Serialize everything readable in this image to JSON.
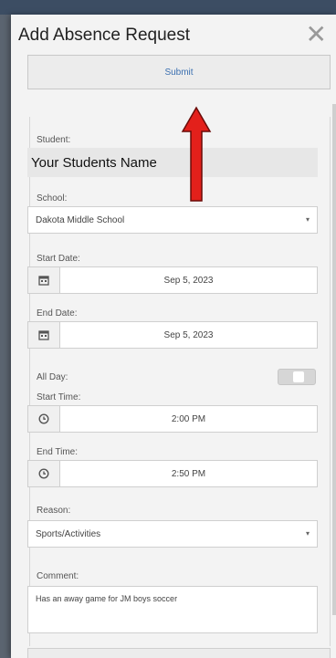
{
  "dialog": {
    "title": "Add Absence Request",
    "close_icon": "close-icon",
    "submit_label": "Submit"
  },
  "form": {
    "student_label": "Student:",
    "student_name": "Your Students Name",
    "school_label": "School:",
    "school_value": "Dakota Middle School",
    "start_date_label": "Start Date:",
    "start_date": "Sep 5, 2023",
    "end_date_label": "End Date:",
    "end_date": "Sep 5, 2023",
    "all_day_label": "All Day:",
    "start_time_label": "Start Time:",
    "start_time": "2:00 PM",
    "end_time_label": "End Time:",
    "end_time": "2:50 PM",
    "reason_label": "Reason:",
    "reason_value": "Sports/Activities",
    "comment_label": "Comment:",
    "comment_value": "Has an away game for JM boys soccer"
  },
  "annotation": {
    "arrow_color": "#e3201b",
    "arrow_icon": "red-up-arrow-icon"
  },
  "colors": {
    "submit_text": "#3a6fb0"
  }
}
